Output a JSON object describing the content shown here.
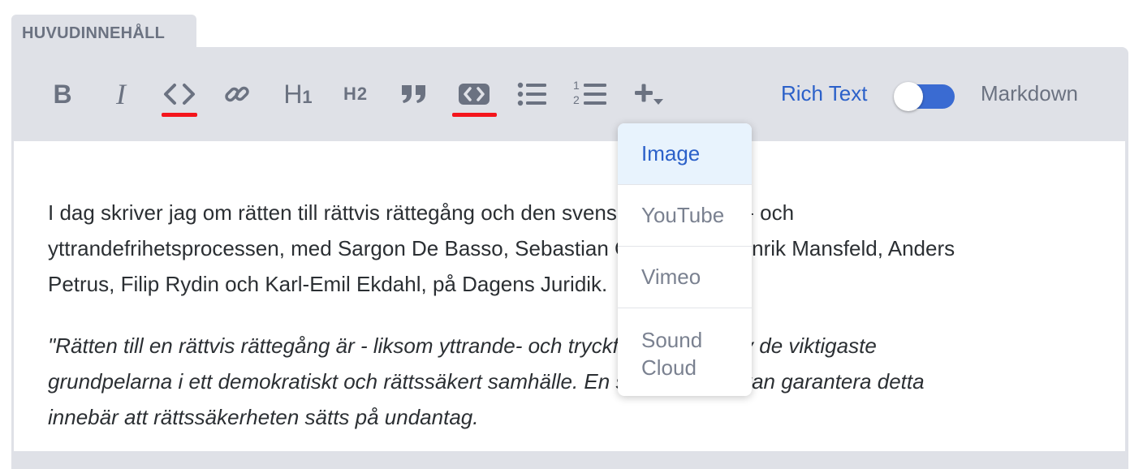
{
  "tab": {
    "label": "HUVUDINNEHÅLL"
  },
  "toolbar": {
    "buttons": [
      {
        "name": "bold",
        "icon": "bold-icon",
        "label": "B"
      },
      {
        "name": "italic",
        "icon": "italic-icon",
        "label": "I"
      },
      {
        "name": "code",
        "icon": "code-icon",
        "label": "<>"
      },
      {
        "name": "link",
        "icon": "link-icon"
      },
      {
        "name": "heading-1",
        "icon": "heading-1-icon",
        "label": "H",
        "sub": "1"
      },
      {
        "name": "heading-2",
        "icon": "heading-2-icon",
        "label": "H2"
      },
      {
        "name": "quote",
        "icon": "quote-icon"
      },
      {
        "name": "code-block",
        "icon": "code-block-icon"
      },
      {
        "name": "bulleted-list",
        "icon": "bulleted-list-icon"
      },
      {
        "name": "numbered-list",
        "icon": "numbered-list-icon",
        "n1": "1",
        "n2": "2"
      },
      {
        "name": "insert",
        "icon": "plus-dropdown-icon"
      }
    ],
    "mode_rich_text": "Rich Text",
    "mode_markdown": "Markdown",
    "toggle_state": "rich-text",
    "highlight_color": "#f4151c",
    "accent_color": "#3a6bd2"
  },
  "insert_menu": {
    "items": [
      {
        "label": "Image",
        "active": true
      },
      {
        "label": "YouTube",
        "active": false
      },
      {
        "label": "Vimeo",
        "active": false
      },
      {
        "label": "Sound Cloud",
        "line1": "Sound",
        "line2": "Cloud",
        "active": false
      }
    ]
  },
  "content": {
    "p1_lines": [
      "I dag skriver jag om rätten till rättvis rättegång och den svenska tryckfrihets- och",
      "yttrandefrihetsprocessen, med Sargon De Basso, Sebastian Cederman, Henrik Mansfeld, Anders",
      "Petrus, Filip Rydin och  Karl-Emil Ekdahl, på Dagens Juridik."
    ],
    "p2_lines": [
      "\"Rätten till en rättvis rättegång är - liksom yttrande- och tryckfriheten - en av de viktigaste",
      "grundpelarna i ett demokratiskt och rättssäkert samhälle. En stat som inte kan garantera detta",
      "innebär att rättssäkerheten sätts på undantag."
    ]
  }
}
